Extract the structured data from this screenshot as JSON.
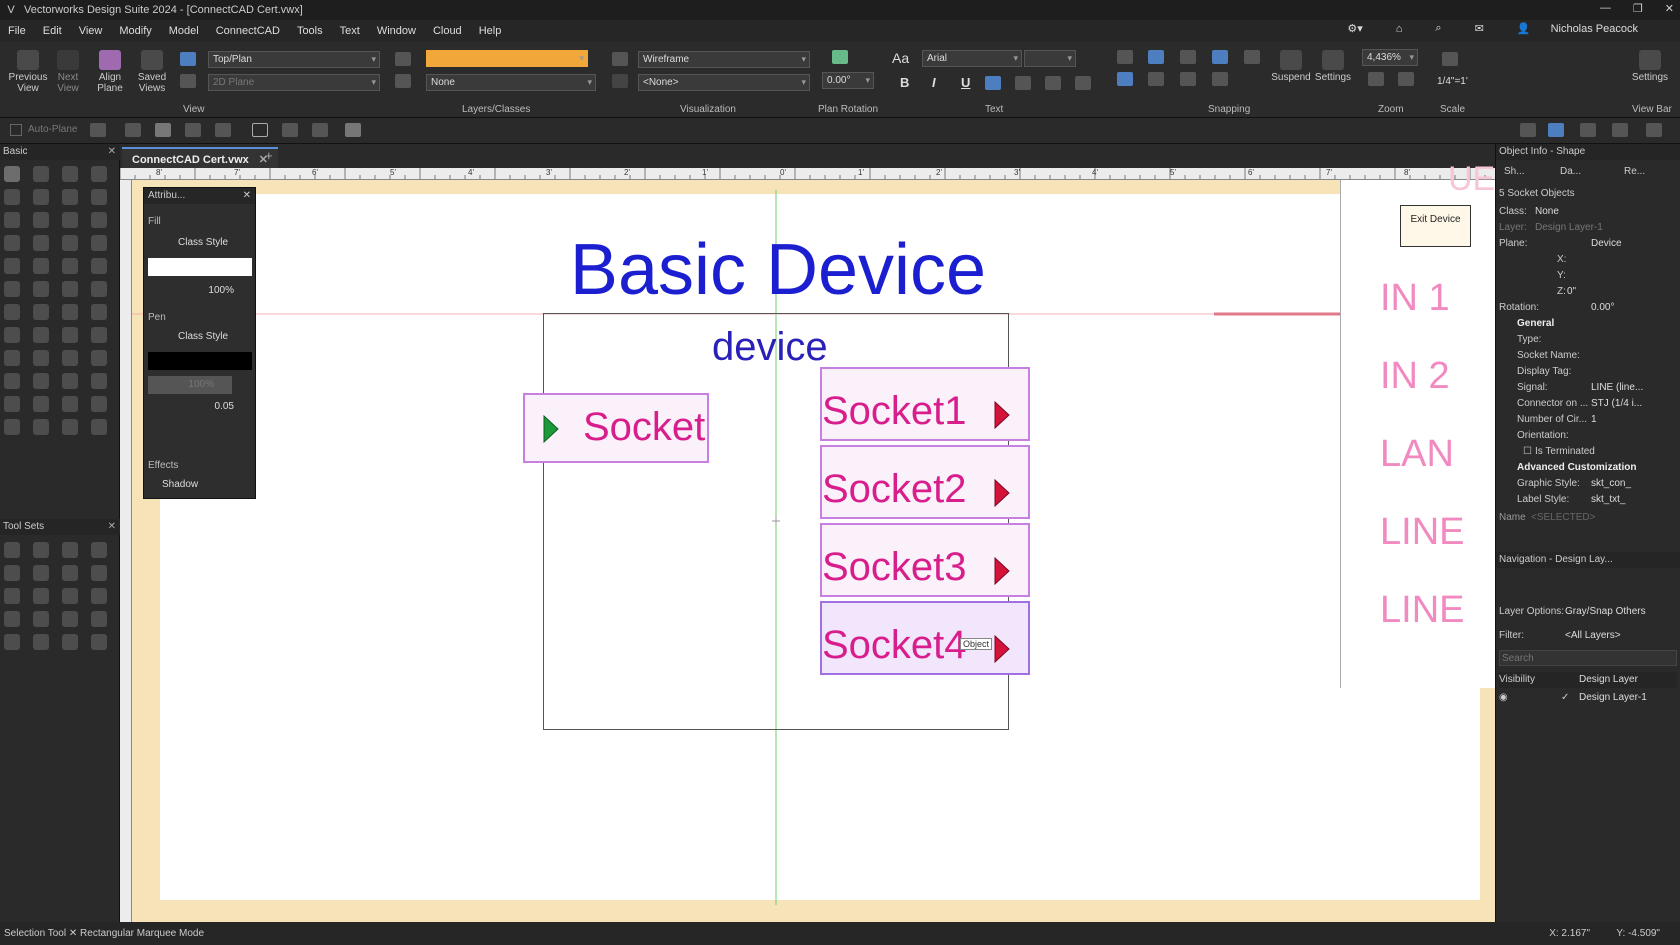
{
  "window": {
    "title": "Vectorworks Design Suite 2024 - [ConnectCAD Cert.vwx]",
    "logo": "V"
  },
  "menu": [
    "File",
    "Edit",
    "View",
    "Modify",
    "Model",
    "ConnectCAD",
    "Tools",
    "Text",
    "Window",
    "Cloud",
    "Help"
  ],
  "user": {
    "name": "Nicholas Peacock"
  },
  "ribbon": {
    "view": {
      "previous": "Previous View",
      "next": "Next View",
      "align": "Align Plane",
      "saved": "Saved Views",
      "view_select": "Top/Plan",
      "plane_select": "2D Plane",
      "group_label": "View"
    },
    "layers": {
      "layer_select": "",
      "class_select": "None",
      "group_label": "Layers/Classes"
    },
    "visualization": {
      "render_select": "Wireframe",
      "light_select": "<None>",
      "group_label": "Visualization"
    },
    "plan_rotation": {
      "value": "0.00°",
      "group_label": "Plan Rotation"
    },
    "text": {
      "font": "Arial",
      "size": "",
      "group_label": "Text",
      "bold": "B",
      "italic": "I",
      "underline": "U"
    },
    "snapping": {
      "suspend": "Suspend",
      "settings": "Settings",
      "group_label": "Snapping"
    },
    "zoom": {
      "value": "4,436%",
      "group_label": "Zoom"
    },
    "scale": {
      "value": "1/4\"=1'",
      "group_label": "Scale"
    },
    "viewbar": {
      "settings": "Settings",
      "group_label": "View Bar"
    }
  },
  "toolbar2": {
    "autoplane": "Auto-Plane"
  },
  "left_panel": {
    "basic_title": "Basic",
    "toolsets_title": "Tool Sets"
  },
  "document": {
    "tab": "ConnectCAD Cert.vwx"
  },
  "attributes": {
    "title": "Attribu...",
    "fill_label": "Fill",
    "fill_style": "Class Style",
    "fill_opacity": "100%",
    "pen_label": "Pen",
    "pen_style": "Class Style",
    "pen_opacity": "100%",
    "pen_weight": "0.05",
    "effects_label": "Effects",
    "shadow_label": "Shadow"
  },
  "canvas": {
    "exit_device": "Exit Device",
    "title": "Basic Device",
    "device_label": "device",
    "socket_left": "Socket",
    "sockets": [
      "Socket1",
      "Socket2",
      "Socket3",
      "Socket4"
    ],
    "snap_hint": "Object",
    "right_labels": [
      "IN 1",
      "IN 2",
      "LAN",
      "LINE",
      "LINE"
    ],
    "right_top": "UE"
  },
  "ruler_ticks": [
    "8'",
    "7'",
    "6'",
    "5'",
    "4'",
    "3'",
    "2'",
    "1'",
    "0'",
    "1'",
    "2'",
    "3'",
    "4'",
    "5'",
    "6'",
    "7'",
    "8'"
  ],
  "object_info": {
    "title": "Object Info - Shape",
    "tabs": [
      "Sh...",
      "Da...",
      "Re..."
    ],
    "selection": "5 Socket Objects",
    "class_k": "Class:",
    "class_v": "None",
    "layer_k": "Layer:",
    "layer_v": "Design Layer-1",
    "plane_k": "Plane:",
    "plane_v": "Device",
    "x_k": "X:",
    "y_k": "Y:",
    "z_k": "Z:",
    "z_v": "0\"",
    "rotation_k": "Rotation:",
    "rotation_v": "0.00°",
    "general": "General",
    "type_k": "Type:",
    "socket_name_k": "Socket Name:",
    "display_tag_k": "Display Tag:",
    "signal_k": "Signal:",
    "signal_v": "LINE (line...",
    "connector_k": "Connector on ...",
    "connector_v": "STJ (1/4 i...",
    "circuits_k": "Number of Cir...",
    "circuits_v": "1",
    "orientation_k": "Orientation:",
    "terminated": "Is Terminated",
    "advanced": "Advanced Customization",
    "graphic_k": "Graphic Style:",
    "graphic_v": "skt_con_",
    "label_k": "Label Style:",
    "label_v": "skt_txt_",
    "name_k": "Name",
    "name_v": "<SELECTED>"
  },
  "navigation": {
    "title": "Navigation - Design Lay...",
    "layer_options_k": "Layer Options:",
    "layer_options_v": "Gray/Snap Others",
    "filter_k": "Filter:",
    "filter_v": "<All Layers>",
    "search_placeholder": "Search",
    "col_visibility": "Visibility",
    "col_design_layer": "Design Layer",
    "row_layer": "Design Layer-1"
  },
  "status": {
    "tool": "Selection Tool",
    "mode": "Rectangular Marquee Mode",
    "x": "X: 2.167\"",
    "y": "Y: -4.509\""
  },
  "colors": {
    "accent_blue": "#1b1fd0",
    "socket_pink": "#d81e8c",
    "socket_border": "#c77fe0",
    "orange_layer": "#f2a73a"
  }
}
